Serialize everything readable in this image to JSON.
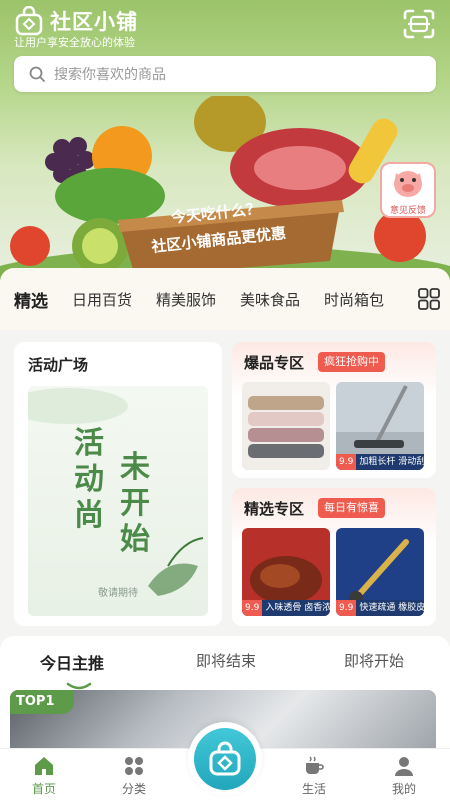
{
  "header": {
    "app_name": "社区小铺",
    "slogan": "让用户享安全放心的体验"
  },
  "search": {
    "placeholder": "搜索你喜欢的商品"
  },
  "banner": {
    "line1": "今天吃什么？",
    "line2": "社区小铺商品更优惠"
  },
  "feedback": {
    "label": "意见反馈"
  },
  "categories": [
    "精选",
    "日用百货",
    "精美服饰",
    "美味食品",
    "时尚箱包"
  ],
  "activity": {
    "title": "活动广场",
    "poster_col1": "活动尚",
    "poster_col2": "未开始",
    "poster_sub": "敬请期待"
  },
  "hot_zone": {
    "title": "爆品专区",
    "badge": "疯狂抢购中",
    "products": [
      {
        "price": "",
        "tag": ""
      },
      {
        "price": "9.9",
        "tag": "加粗长杆 滑动刮"
      }
    ]
  },
  "pick_zone": {
    "title": "精选专区",
    "badge": "每日有惊喜",
    "products": [
      {
        "price": "9.9",
        "tag": "入味透骨 卤香浓"
      },
      {
        "price": "9.9",
        "tag": "快速疏通 橡胶皮"
      }
    ]
  },
  "rec_tabs": [
    "今日主推",
    "即将结束",
    "即将开始"
  ],
  "top_badge": "TOP1",
  "tabbar": [
    "首页",
    "分类",
    "生活",
    "我的"
  ],
  "colors": {
    "brand_green": "#5d9a4a",
    "accent_red": "#ef5b4f",
    "center_teal": "#22a6bc"
  }
}
